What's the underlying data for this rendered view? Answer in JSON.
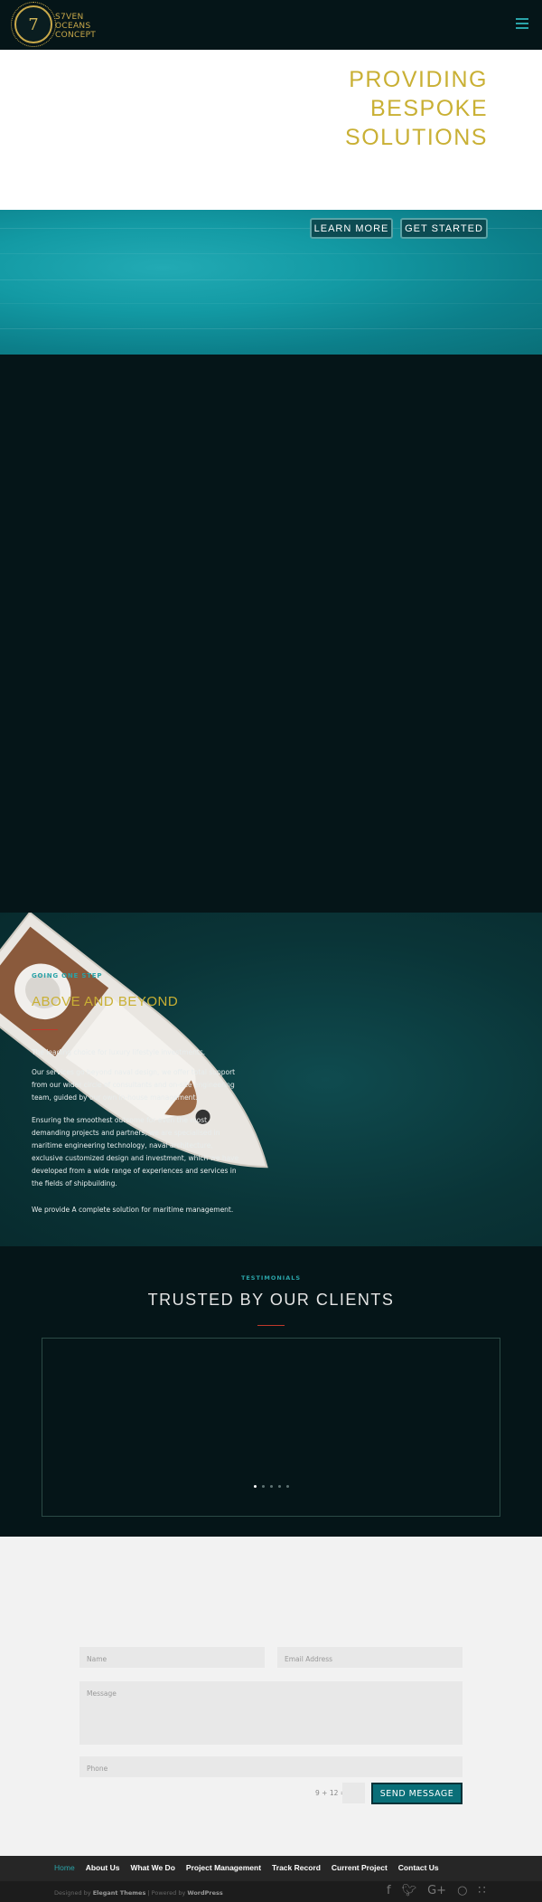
{
  "header": {
    "logo_numeral": "7",
    "logo_line1": "S7VEN",
    "logo_line2": "OCEANS",
    "logo_line3": "CONCEPT"
  },
  "hero": {
    "title_line1": "PROVIDING",
    "title_line2": "BESPOKE",
    "title_line3": "SOLUTIONS",
    "learn_more": "LEARN MORE",
    "get_started": "GET STARTED"
  },
  "about": {
    "eyebrow": "GOING ONE STEP",
    "title": "ABOVE AND BEYOND",
    "p1": "The leading choice for luxury lifestyle investments.",
    "p2": "Our services go beyond naval design, we offer total support from our wider circle of consultants and on-site engineering team, guided by our own in-house management.",
    "p3": "Ensuring the smoothest outcome for even the most demanding projects and partners, we are specialised in maritime engineering technology, naval architecture, exclusive customized design and investment, which we have developed from a wide range of experiences and services in the fields of shipbuilding.",
    "p4": "We provide A complete solution for maritime management."
  },
  "testimonials": {
    "eyebrow": "TESTIMONIALS",
    "title": "TRUSTED BY OUR CLIENTS",
    "slide_count": 5,
    "active_slide": 1
  },
  "contact": {
    "name_placeholder": "Name",
    "email_placeholder": "Email Address",
    "message_placeholder": "Message",
    "phone_placeholder": "Phone",
    "captcha": "9 + 12 =",
    "send_label": "SEND MESSAGE"
  },
  "footer": {
    "nav": [
      "Home",
      "About Us",
      "What We Do",
      "Project Management",
      "Track Record",
      "Current Project",
      "Contact Us"
    ],
    "credits_prefix": "Designed by ",
    "credits_brand1": "Elegant Themes",
    "credits_mid": " | Powered by ",
    "credits_brand2": "WordPress",
    "social_icons": [
      "facebook-icon",
      "twitter-icon",
      "google-plus-icon",
      "instagram-icon",
      "rss-icon"
    ]
  },
  "colors": {
    "dark_bg": "#051518",
    "gold": "#c9b034",
    "teal": "#2aa3a8",
    "button_teal": "#0a6f78",
    "accent_red": "#c0392b"
  }
}
